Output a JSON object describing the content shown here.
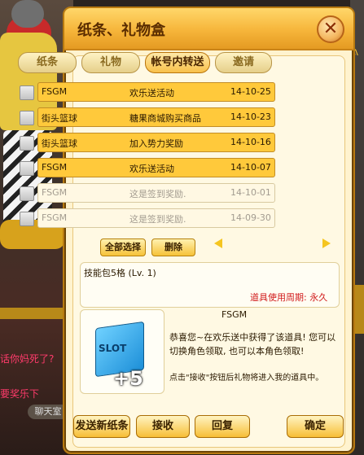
{
  "scene": {
    "chat_lines": [
      "话你妈死了?",
      "要奖乐下"
    ],
    "chat_button": "聊天室"
  },
  "window": {
    "title": "纸条、礼物盒",
    "close_icon": "close-icon"
  },
  "tabs": [
    {
      "label": "纸条",
      "active": false
    },
    {
      "label": "礼物",
      "active": false
    },
    {
      "label": "帐号内转送",
      "active": true
    },
    {
      "label": "邀请",
      "active": false
    }
  ],
  "rows": [
    {
      "sender": "FSGM",
      "subject": "欢乐送活动",
      "date": "14-10-25",
      "read": false
    },
    {
      "sender": "街头篮球",
      "subject": "糖果商城购买商品",
      "date": "14-10-23",
      "read": false
    },
    {
      "sender": "街头篮球",
      "subject": "加入势力奖励",
      "date": "14-10-16",
      "read": false
    },
    {
      "sender": "FSGM",
      "subject": "欢乐送活动",
      "date": "14-10-07",
      "read": false
    },
    {
      "sender": "FSGM",
      "subject": "这是签到奖励.",
      "date": "14-10-01",
      "read": true
    },
    {
      "sender": "FSGM",
      "subject": "这是签到奖励.",
      "date": "14-09-30",
      "read": true
    }
  ],
  "list_controls": {
    "select_all": "全部选择",
    "delete": "删除"
  },
  "item": {
    "name": "技能包5格 (Lv. 1)",
    "period": "道具使用周期: 永久",
    "icon_label": "SLOT",
    "icon_badge": "+5"
  },
  "gift": {
    "sender": "FSGM",
    "message": "恭喜您~在欢乐送中获得了该道具! 您可以切换角色领取, 也可以本角色领取!",
    "note": "点击\"接收\"按钮后礼物将进入我的道具中。"
  },
  "buttons": {
    "send_new": "发送新纸条",
    "receive": "接收",
    "reply": "回复",
    "confirm": "确定"
  },
  "colors": {
    "title_gradient": "#f6b53a",
    "unread_row": "#ffc93b",
    "period_text": "#d11b1b"
  }
}
